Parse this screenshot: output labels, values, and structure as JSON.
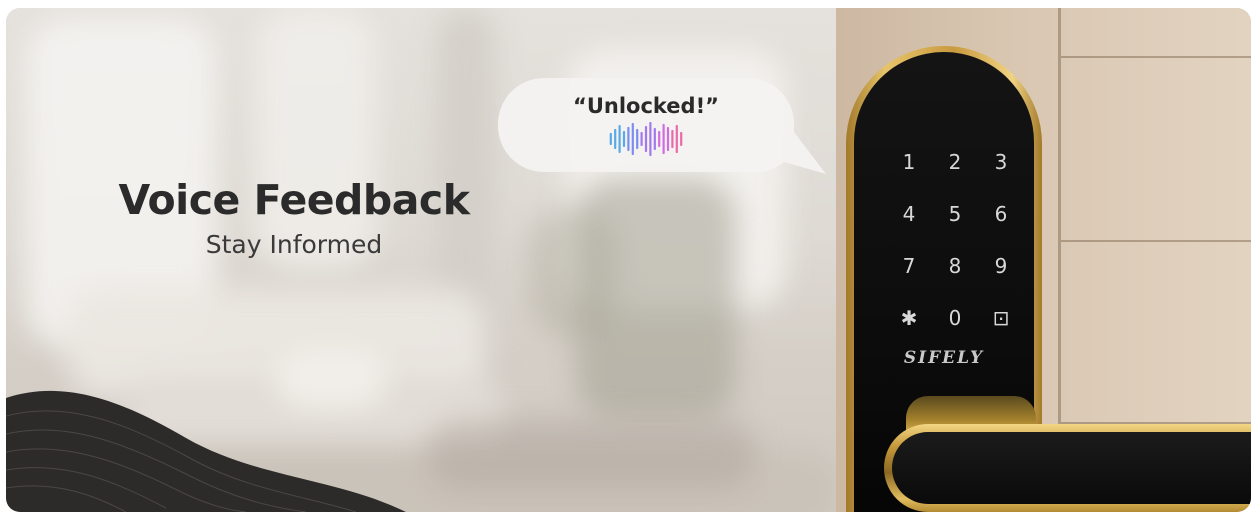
{
  "headline": {
    "title": "Voice Feedback",
    "subtitle": "Stay Informed"
  },
  "bubble": {
    "text": "“Unlocked!”",
    "wave_colors": [
      "#5aa9e6",
      "#7b8ef0",
      "#a178ee",
      "#d06be0",
      "#e86aa8"
    ]
  },
  "lock": {
    "keys": [
      "1",
      "2",
      "3",
      "4",
      "5",
      "6",
      "7",
      "8",
      "9",
      "✱",
      "0",
      "⊡"
    ],
    "brand": "SIFELY",
    "colors": {
      "gold": "#d4ad54",
      "face": "#0c0c0c",
      "keys": "#d8d8d8"
    }
  },
  "colors": {
    "headline_text": "#2b2b2b",
    "wave_dark": "#2d2b2a",
    "door_wood": "#d8c6b1"
  }
}
